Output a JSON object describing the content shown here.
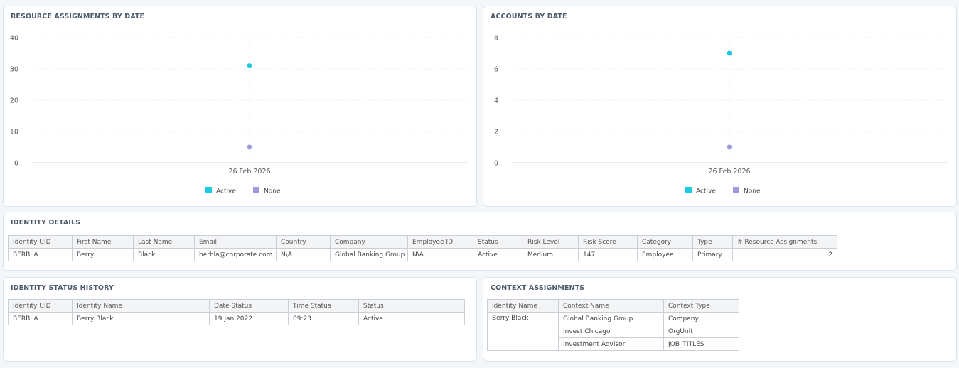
{
  "chart_data": [
    {
      "type": "scatter",
      "title": "RESOURCE ASSIGNMENTS BY DATE",
      "categories": [
        "26 Feb 2026"
      ],
      "ylim": [
        0,
        40
      ],
      "yticks": [
        0,
        10,
        20,
        30,
        40
      ],
      "grid": true,
      "legend": "bottom-center",
      "series": [
        {
          "name": "Active",
          "values": [
            31
          ],
          "color": "#1ec8df"
        },
        {
          "name": "None",
          "values": [
            5
          ],
          "color": "#9e9bd9"
        }
      ]
    },
    {
      "type": "scatter",
      "title": "ACCOUNTS BY DATE",
      "categories": [
        "26 Feb 2026"
      ],
      "ylim": [
        0,
        8
      ],
      "yticks": [
        0,
        2,
        4,
        6,
        8
      ],
      "grid": true,
      "legend": "bottom-center",
      "series": [
        {
          "name": "Active",
          "values": [
            7
          ],
          "color": "#1ec8df"
        },
        {
          "name": "None",
          "values": [
            1
          ],
          "color": "#9e9bd9"
        }
      ]
    }
  ],
  "identity_details": {
    "title": "IDENTITY DETAILS",
    "columns": [
      "Identity UID",
      "First Name",
      "Last Name",
      "Email",
      "Country",
      "Company",
      "Employee ID",
      "Status",
      "Risk Level",
      "Risk Score",
      "Category",
      "Type",
      "# Resource Assignments"
    ],
    "rows": [
      [
        "BERBLA",
        "Berry",
        "Black",
        "berbla@corporate.com",
        "N\\A",
        "Global Banking Group",
        "N\\A",
        "Active",
        "Medium",
        "147",
        "Employee",
        "Primary",
        "2"
      ]
    ]
  },
  "status_history": {
    "title": "IDENTITY STATUS HISTORY",
    "columns": [
      "Identity UID",
      "Identity Name",
      "Date Status",
      "Time Status",
      "Status"
    ],
    "rows": [
      [
        "BERBLA",
        "Berry Black",
        "19 Jan 2022",
        "09:23",
        "Active"
      ]
    ]
  },
  "context_assignments": {
    "title": "CONTEXT ASSIGNMENTS",
    "columns": [
      "Identity Name",
      "Context Name",
      "Context Type"
    ],
    "identity_name": "Berry Black",
    "rows": [
      [
        "Global Banking Group",
        "Company"
      ],
      [
        "Invest Chicago",
        "OrgUnit"
      ],
      [
        "Investment Advisor",
        "JOB_TITLES"
      ]
    ]
  }
}
